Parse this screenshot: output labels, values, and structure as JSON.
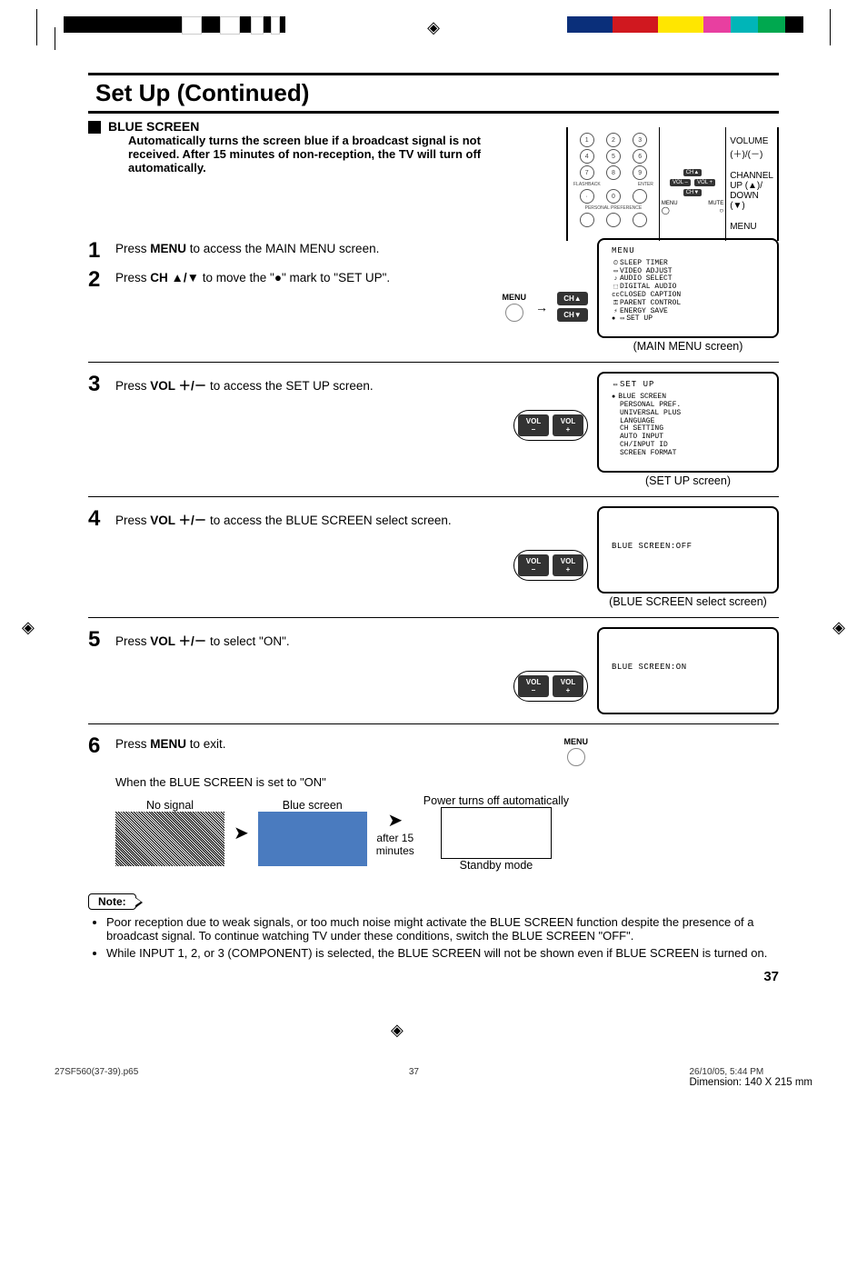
{
  "page_title": "Set Up (Continued)",
  "blue_screen": {
    "heading": "BLUE SCREEN",
    "body": "Automatically turns the screen blue if a broadcast signal is not received. After 15 minutes of non-reception, the TV will turn off automatically."
  },
  "remote_labels": {
    "volume": "VOLUME",
    "vol_sym": "(＋)/(－)",
    "channel": "CHANNEL",
    "ch_sym_up": "UP (▲)/",
    "ch_sym_down": "DOWN (▼)",
    "menu": "MENU",
    "flashback": "FLASHBACK",
    "enter": "ENTER",
    "pref": "PERSONAL PREFERENCE",
    "menu_small": "MENU",
    "mute_small": "MUTE"
  },
  "steps": {
    "s1": {
      "num": "1",
      "text_a": "Press ",
      "text_b": " to access the MAIN MENU screen.",
      "key": "MENU"
    },
    "s2": {
      "num": "2",
      "text_a": "Press ",
      "text_b": " to move the \"●\" mark to \"SET UP\".",
      "key": "CH ▲/▼",
      "menu_label": "MENU",
      "ch_up": "CH▲",
      "ch_down": "CH▼"
    },
    "s3": {
      "num": "3",
      "text_a": "Press ",
      "text_b": "  to access the SET UP screen.",
      "key": "VOL ＋/－",
      "vol_minus": "VOL\n–",
      "vol_plus": "VOL\n+"
    },
    "s4": {
      "num": "4",
      "text_a": "Press ",
      "text_b": "  to access the BLUE SCREEN select screen.",
      "key": "VOL ＋/－",
      "vol_minus": "VOL\n–",
      "vol_plus": "VOL\n+"
    },
    "s5": {
      "num": "5",
      "text_a": "Press ",
      "text_b": "  to select \"ON\".",
      "key": "VOL ＋/－",
      "vol_minus": "VOL\n–",
      "vol_plus": "VOL\n+"
    },
    "s6": {
      "num": "6",
      "text_a": "Press ",
      "text_b": " to exit.",
      "key": "MENU",
      "menu_label": "MENU",
      "sub": "When the BLUE SCREEN is set to \"ON\"",
      "no_signal": "No signal",
      "blue_screen": "Blue screen",
      "power_off": "Power turns off automatically",
      "after": "after 15",
      "minutes": "minutes",
      "standby": "Standby mode"
    }
  },
  "screens": {
    "main_menu": {
      "title": "MENU",
      "items": [
        "SLEEP TIMER",
        "VIDEO ADJUST",
        "AUDIO SELECT",
        "DIGITAL AUDIO",
        "CLOSED CAPTION",
        "PARENT CONTROL",
        "ENERGY SAVE",
        "SET UP"
      ],
      "caption": "(MAIN MENU screen)"
    },
    "setup": {
      "title": "SET UP",
      "items": [
        "BLUE SCREEN",
        "PERSONAL PREF.",
        "UNIVERSAL PLUS",
        "LANGUAGE",
        "CH SETTING",
        "AUTO INPUT",
        "CH/INPUT ID",
        "SCREEN FORMAT"
      ],
      "caption": "(SET UP screen)"
    },
    "blue_off": {
      "text": "BLUE SCREEN:OFF",
      "caption": "(BLUE SCREEN select screen)"
    },
    "blue_on": {
      "text": "BLUE SCREEN:ON"
    }
  },
  "note": {
    "label": "Note:",
    "items": [
      "Poor reception due to weak signals, or too much noise might activate the BLUE SCREEN function despite the presence of a broadcast signal. To continue watching TV under these conditions, switch the BLUE SCREEN \"OFF\".",
      "While INPUT 1, 2, or 3 (COMPONENT) is selected, the BLUE SCREEN will not be shown even if BLUE SCREEN is turned on."
    ]
  },
  "page_number": "37",
  "footer": {
    "file": "27SF560(37-39).p65",
    "page": "37",
    "date": "26/10/05, 5:44 PM",
    "dimension": "Dimension: 140  X 215 mm"
  }
}
